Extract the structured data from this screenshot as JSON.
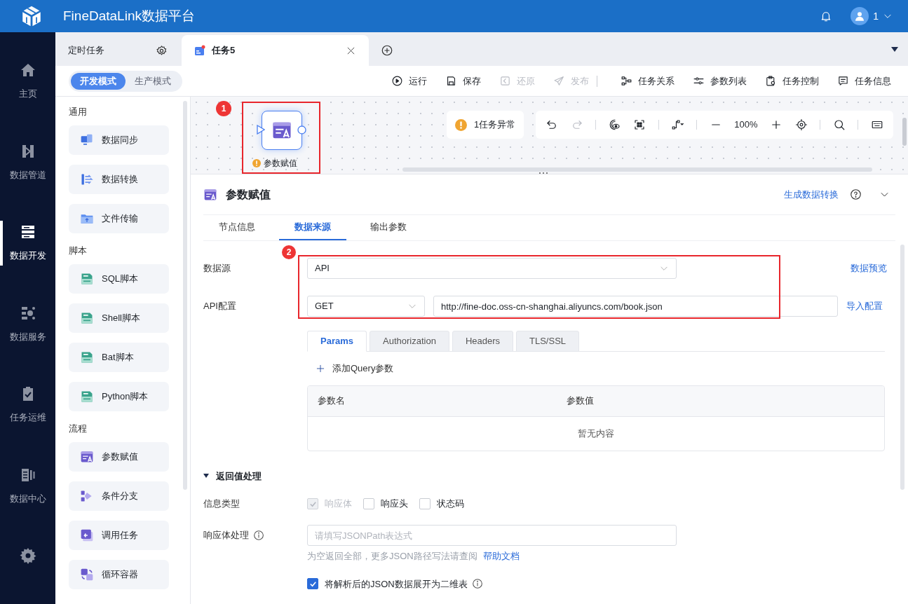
{
  "app": {
    "title": "FineDataLink数据平台",
    "user": "1"
  },
  "nav": [
    {
      "label": "主页",
      "kind": "home",
      "selected": false
    },
    {
      "label": "数据管道",
      "kind": "pipeline",
      "selected": false
    },
    {
      "label": "数据开发",
      "kind": "dev",
      "selected": true
    },
    {
      "label": "数据服务",
      "kind": "service",
      "selected": false
    },
    {
      "label": "任务运维",
      "kind": "ops",
      "selected": false
    },
    {
      "label": "数据中心",
      "kind": "center",
      "selected": false
    },
    {
      "kind": "settings"
    }
  ],
  "tabs": [
    {
      "label": "定时任务",
      "kind": "folder",
      "selected": false
    },
    {
      "label": "任务5",
      "kind": "task",
      "selected": true
    }
  ],
  "modes": [
    {
      "label": "开发模式",
      "selected": true
    },
    {
      "label": "生产模式",
      "selected": false
    }
  ],
  "actions": [
    {
      "label": "运行",
      "kind": "play",
      "disabled": false
    },
    {
      "label": "保存",
      "kind": "save",
      "disabled": false
    },
    {
      "label": "还原",
      "kind": "restore",
      "disabled": true
    },
    {
      "label": "发布",
      "kind": "publish",
      "disabled": true
    },
    {
      "kind": "divider"
    },
    {
      "label": "任务关系",
      "kind": "relation",
      "disabled": false
    },
    {
      "label": "参数列表",
      "kind": "params",
      "disabled": false
    },
    {
      "label": "任务控制",
      "kind": "control",
      "disabled": false
    },
    {
      "label": "任务信息",
      "kind": "info",
      "disabled": false
    }
  ],
  "palette": [
    {
      "heading": "通用",
      "items": [
        {
          "label": "数据同步",
          "kind": "sync"
        },
        {
          "label": "数据转换",
          "kind": "transform"
        },
        {
          "label": "文件传输",
          "kind": "file"
        }
      ]
    },
    {
      "heading": "脚本",
      "items": [
        {
          "label": "SQL脚本",
          "kind": "script"
        },
        {
          "label": "Shell脚本",
          "kind": "script"
        },
        {
          "label": "Bat脚本",
          "kind": "script"
        },
        {
          "label": "Python脚本",
          "kind": "script"
        }
      ]
    },
    {
      "heading": "流程",
      "items": [
        {
          "label": "参数赋值",
          "kind": "param"
        },
        {
          "label": "条件分支",
          "kind": "branch"
        },
        {
          "label": "调用任务",
          "kind": "call"
        },
        {
          "label": "循环容器",
          "kind": "loop"
        }
      ]
    }
  ],
  "canvas": {
    "annotation": "1",
    "node": {
      "label": "参数赋值",
      "warning": true
    },
    "alert": "1任务异常",
    "tools": [
      {
        "kind": "undo",
        "disabled": false
      },
      {
        "kind": "redo",
        "disabled": true
      },
      {
        "kind": "divider"
      },
      {
        "kind": "view",
        "disabled": false
      },
      {
        "kind": "fit",
        "disabled": false
      },
      {
        "kind": "divider"
      },
      {
        "kind": "route",
        "disabled": false
      },
      {
        "kind": "divider"
      },
      {
        "kind": "zoom-out",
        "disabled": false
      },
      {
        "kind": "zoom",
        "text": "100%"
      },
      {
        "kind": "zoom-in",
        "disabled": false
      },
      {
        "kind": "locate",
        "disabled": false
      },
      {
        "kind": "divider"
      },
      {
        "kind": "search",
        "disabled": false
      },
      {
        "kind": "divider"
      },
      {
        "kind": "keyboard",
        "disabled": false
      }
    ]
  },
  "panel": {
    "title": "参数赋值",
    "link": "生成数据转换",
    "tabs": [
      {
        "label": "节点信息",
        "selected": false
      },
      {
        "label": "数据来源",
        "selected": true
      },
      {
        "label": "输出参数",
        "selected": false
      }
    ],
    "annotation": "2",
    "source": {
      "label": "数据源",
      "value": "API",
      "preview": "数据预览"
    },
    "api": {
      "label": "API配置",
      "method": "GET",
      "url": "http://fine-doc.oss-cn-shanghai.aliyuncs.com/book.json",
      "import": "导入配置"
    },
    "request_tabs": [
      {
        "label": "Params",
        "selected": true
      },
      {
        "label": "Authorization",
        "selected": false
      },
      {
        "label": "Headers",
        "selected": false
      },
      {
        "label": "TLS/SSL",
        "selected": false
      }
    ],
    "add_param": "添加Query参数",
    "params_table": {
      "columns": [
        "参数名",
        "参数值"
      ],
      "empty": "暂无内容"
    },
    "return": {
      "title": "返回值处理",
      "expanded": true,
      "type_label": "信息类型",
      "types": [
        {
          "label": "响应体",
          "checked": true,
          "disabled": true
        },
        {
          "label": "响应头",
          "checked": false,
          "disabled": false
        },
        {
          "label": "状态码",
          "checked": false,
          "disabled": false
        }
      ],
      "body_label": "响应体处理",
      "body_placeholder": "请填写JSONPath表达式",
      "hint": "为空返回全部，更多JSON路径写法请查阅",
      "help_link": "帮助文档",
      "flatten": {
        "label": "将解析后的JSON数据展开为二维表",
        "checked": true
      }
    }
  }
}
